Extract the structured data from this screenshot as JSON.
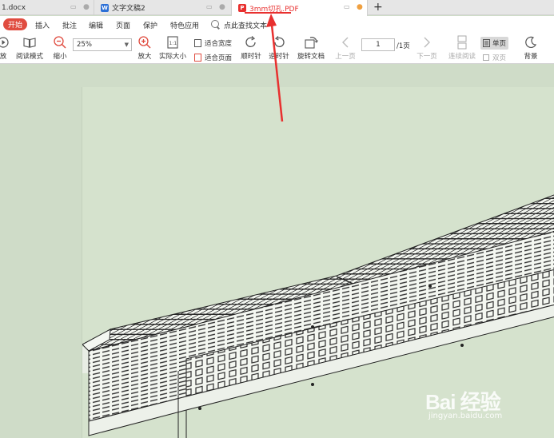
{
  "tabs": [
    {
      "label": "1.docx",
      "icon": "doc-icon",
      "active": false
    },
    {
      "label": "文字文稿2",
      "icon": "word-icon",
      "active": false
    },
    {
      "label": "3mm切孔.PDF",
      "icon": "pdf-icon",
      "active": true
    }
  ],
  "new_tab_label": "+",
  "menu": {
    "start": "开始",
    "items": [
      "插入",
      "批注",
      "编辑",
      "页面",
      "保护",
      "特色应用"
    ],
    "search": "点此查找文本"
  },
  "ribbon": {
    "play": "放",
    "read_mode": "阅读模式",
    "zoom_out": "缩小",
    "zoom_value": "25%",
    "zoom_in": "放大",
    "actual_size": "实际大小",
    "fit_width": "适合宽度",
    "fit_page": "适合页面",
    "rotate_cw": "顺时针",
    "rotate_ccw": "逆时针",
    "rotate_doc": "旋转文档",
    "prev_page": "上一页",
    "page_current": "1",
    "page_total": "/1页",
    "next_page": "下一页",
    "continuous": "连续阅读",
    "single": "单页",
    "double": "双页",
    "background": "背景"
  },
  "watermark": {
    "logo": "Bai 经验",
    "url": "jingyan.baidu.com"
  },
  "colors": {
    "accent": "#e04c40",
    "pdf_tab": "#e8302f",
    "annotation": "#e8302f",
    "doc_bg": "#cfdcc8"
  }
}
